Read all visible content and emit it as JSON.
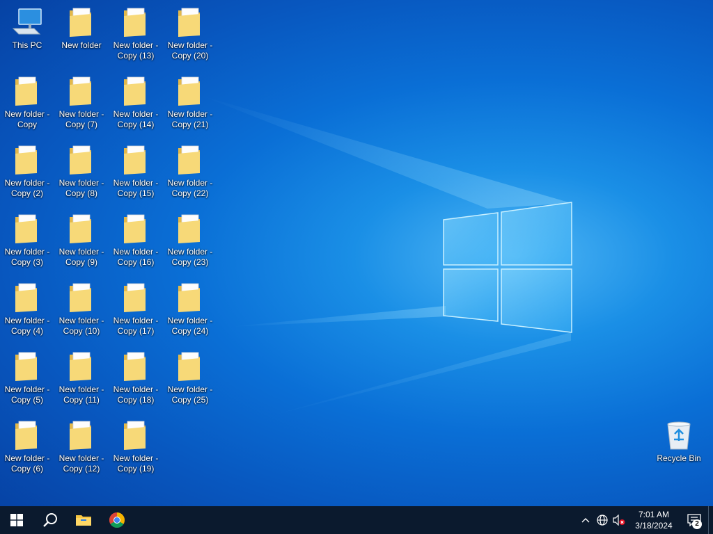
{
  "desktop": {
    "icons": [
      {
        "name": "this-pc",
        "label": "This PC",
        "type": "pc"
      },
      {
        "name": "folder-new",
        "label": "New folder",
        "type": "folder"
      },
      {
        "name": "folder-copy-13",
        "label": "New folder -\nCopy (13)",
        "type": "folder"
      },
      {
        "name": "folder-copy-20",
        "label": "New folder -\nCopy (20)",
        "type": "folder"
      },
      {
        "name": "folder-copy",
        "label": "New folder -\nCopy",
        "type": "folder"
      },
      {
        "name": "folder-copy-7",
        "label": "New folder -\nCopy (7)",
        "type": "folder"
      },
      {
        "name": "folder-copy-14",
        "label": "New folder -\nCopy (14)",
        "type": "folder"
      },
      {
        "name": "folder-copy-21",
        "label": "New folder -\nCopy (21)",
        "type": "folder"
      },
      {
        "name": "folder-copy-2",
        "label": "New folder -\nCopy (2)",
        "type": "folder"
      },
      {
        "name": "folder-copy-8",
        "label": "New folder -\nCopy (8)",
        "type": "folder"
      },
      {
        "name": "folder-copy-15",
        "label": "New folder -\nCopy (15)",
        "type": "folder"
      },
      {
        "name": "folder-copy-22",
        "label": "New folder -\nCopy (22)",
        "type": "folder"
      },
      {
        "name": "folder-copy-3",
        "label": "New folder -\nCopy (3)",
        "type": "folder"
      },
      {
        "name": "folder-copy-9",
        "label": "New folder -\nCopy (9)",
        "type": "folder"
      },
      {
        "name": "folder-copy-16",
        "label": "New folder -\nCopy (16)",
        "type": "folder"
      },
      {
        "name": "folder-copy-23",
        "label": "New folder -\nCopy (23)",
        "type": "folder"
      },
      {
        "name": "folder-copy-4",
        "label": "New folder -\nCopy (4)",
        "type": "folder"
      },
      {
        "name": "folder-copy-10",
        "label": "New folder -\nCopy (10)",
        "type": "folder"
      },
      {
        "name": "folder-copy-17",
        "label": "New folder -\nCopy (17)",
        "type": "folder"
      },
      {
        "name": "folder-copy-24",
        "label": "New folder -\nCopy (24)",
        "type": "folder"
      },
      {
        "name": "folder-copy-5",
        "label": "New folder -\nCopy (5)",
        "type": "folder"
      },
      {
        "name": "folder-copy-11",
        "label": "New folder -\nCopy (11)",
        "type": "folder"
      },
      {
        "name": "folder-copy-18",
        "label": "New folder -\nCopy (18)",
        "type": "folder"
      },
      {
        "name": "folder-copy-25",
        "label": "New folder -\nCopy (25)",
        "type": "folder"
      },
      {
        "name": "folder-copy-6",
        "label": "New folder -\nCopy (6)",
        "type": "folder"
      },
      {
        "name": "folder-copy-12",
        "label": "New folder -\nCopy (12)",
        "type": "folder"
      },
      {
        "name": "folder-copy-19",
        "label": "New folder -\nCopy (19)",
        "type": "folder"
      }
    ],
    "recycle_bin": {
      "label": "Recycle Bin"
    }
  },
  "taskbar": {
    "buttons": [
      {
        "name": "start-button",
        "icon": "windows-logo-icon"
      },
      {
        "name": "search-button",
        "icon": "search-icon"
      },
      {
        "name": "file-explorer-button",
        "icon": "file-explorer-icon"
      },
      {
        "name": "chrome-button",
        "icon": "chrome-icon"
      }
    ],
    "tray": {
      "icons": [
        "chevron-up-icon",
        "network-globe-icon",
        "speaker-muted-icon"
      ],
      "clock": {
        "time": "7:01 AM",
        "date": "3/18/2024"
      },
      "notification_count": "2"
    }
  },
  "colors": {
    "taskbar": "#0b1a2e",
    "folder": "#f5d46b",
    "wallpaper_blue": "#0a6fd6"
  }
}
